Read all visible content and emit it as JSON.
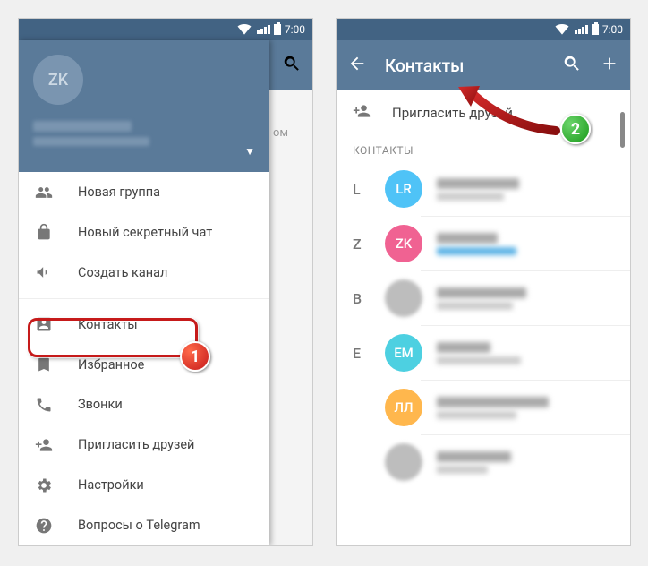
{
  "statusbar": {
    "time": "7:00"
  },
  "left": {
    "avatar_initials": "ZK",
    "menu": {
      "new_group": "Новая группа",
      "secret_chat": "Новый секретный чат",
      "channel": "Создать канал",
      "contacts": "Контакты",
      "saved": "Избранное",
      "calls": "Звонки",
      "invite": "Пригласить друзей",
      "settings": "Настройки",
      "faq": "Вопросы о Telegram"
    },
    "bg_hint": "ом"
  },
  "right": {
    "title": "Контакты",
    "invite": "Пригласить друзей",
    "section": "КОНТАКТЫ",
    "contacts": [
      {
        "letter": "L",
        "initials": "LR",
        "color": "#4fc3f7"
      },
      {
        "letter": "Z",
        "initials": "ZK",
        "color": "#f06292",
        "online": true
      },
      {
        "letter": "B",
        "initials": "",
        "color": "#bdbdbd",
        "img": true
      },
      {
        "letter": "E",
        "initials": "EM",
        "color": "#4dd0e1"
      },
      {
        "letter": "",
        "initials": "ЛЛ",
        "color": "#ffb74d"
      },
      {
        "letter": "",
        "initials": "",
        "color": "#bdbdbd",
        "img": true
      }
    ]
  },
  "callouts": {
    "one": "1",
    "two": "2"
  }
}
